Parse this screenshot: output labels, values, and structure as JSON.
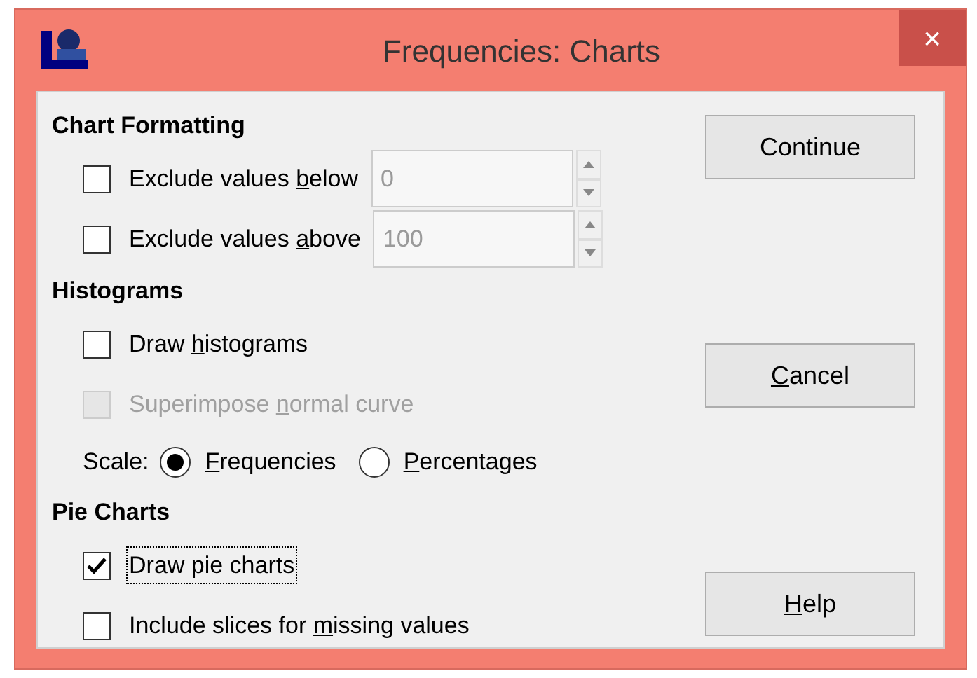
{
  "window": {
    "title": "Frequencies: Charts",
    "close": "×"
  },
  "sections": [
    {
      "heading": "Chart Formatting",
      "rows": [
        {
          "kind": "checkbox_field",
          "before": "Exclude values ",
          "key": "b",
          "after": "elow",
          "checked": false,
          "disabled": false,
          "focused": false,
          "value": "0"
        },
        {
          "kind": "checkbox_field",
          "before": "Exclude values ",
          "key": "a",
          "after": "bove",
          "checked": false,
          "disabled": false,
          "focused": false,
          "value": "100"
        }
      ]
    },
    {
      "heading": "Histograms",
      "rows": [
        {
          "kind": "checkbox",
          "before": "Draw ",
          "key": "h",
          "after": "istograms",
          "checked": false,
          "disabled": false,
          "focused": false
        },
        {
          "kind": "checkbox",
          "before": "Superimpose ",
          "key": "n",
          "after": "ormal curve",
          "checked": false,
          "disabled": true,
          "focused": false
        },
        {
          "kind": "radio_group",
          "label": "Scale:",
          "options": [
            {
              "key": "F",
              "after": "requencies",
              "selected": true
            },
            {
              "key": "P",
              "after": "ercentages",
              "selected": false
            }
          ]
        }
      ]
    },
    {
      "heading": "Pie Charts",
      "rows": [
        {
          "kind": "checkbox",
          "before": "Draw pie charts",
          "checked": true,
          "disabled": false,
          "focused": true
        },
        {
          "kind": "checkbox",
          "before": "Include slices for ",
          "key": "m",
          "after": "issing values",
          "checked": false,
          "disabled": false,
          "focused": false
        }
      ]
    }
  ],
  "buttons": [
    {
      "before": "Continue"
    },
    {
      "key": "C",
      "after": "ancel"
    },
    {
      "key": "H",
      "after": "elp"
    }
  ]
}
